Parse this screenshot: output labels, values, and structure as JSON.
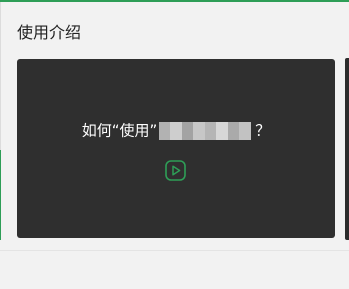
{
  "section": {
    "title": "使用介绍"
  },
  "video": {
    "title_prefix": "如何“使用”",
    "title_suffix": "？",
    "play_icon": "play-icon",
    "accent_color": "#2e9e57"
  },
  "colors": {
    "background": "#f2f2f2",
    "card": "#2f2f2f",
    "accent": "#2e9e57"
  }
}
